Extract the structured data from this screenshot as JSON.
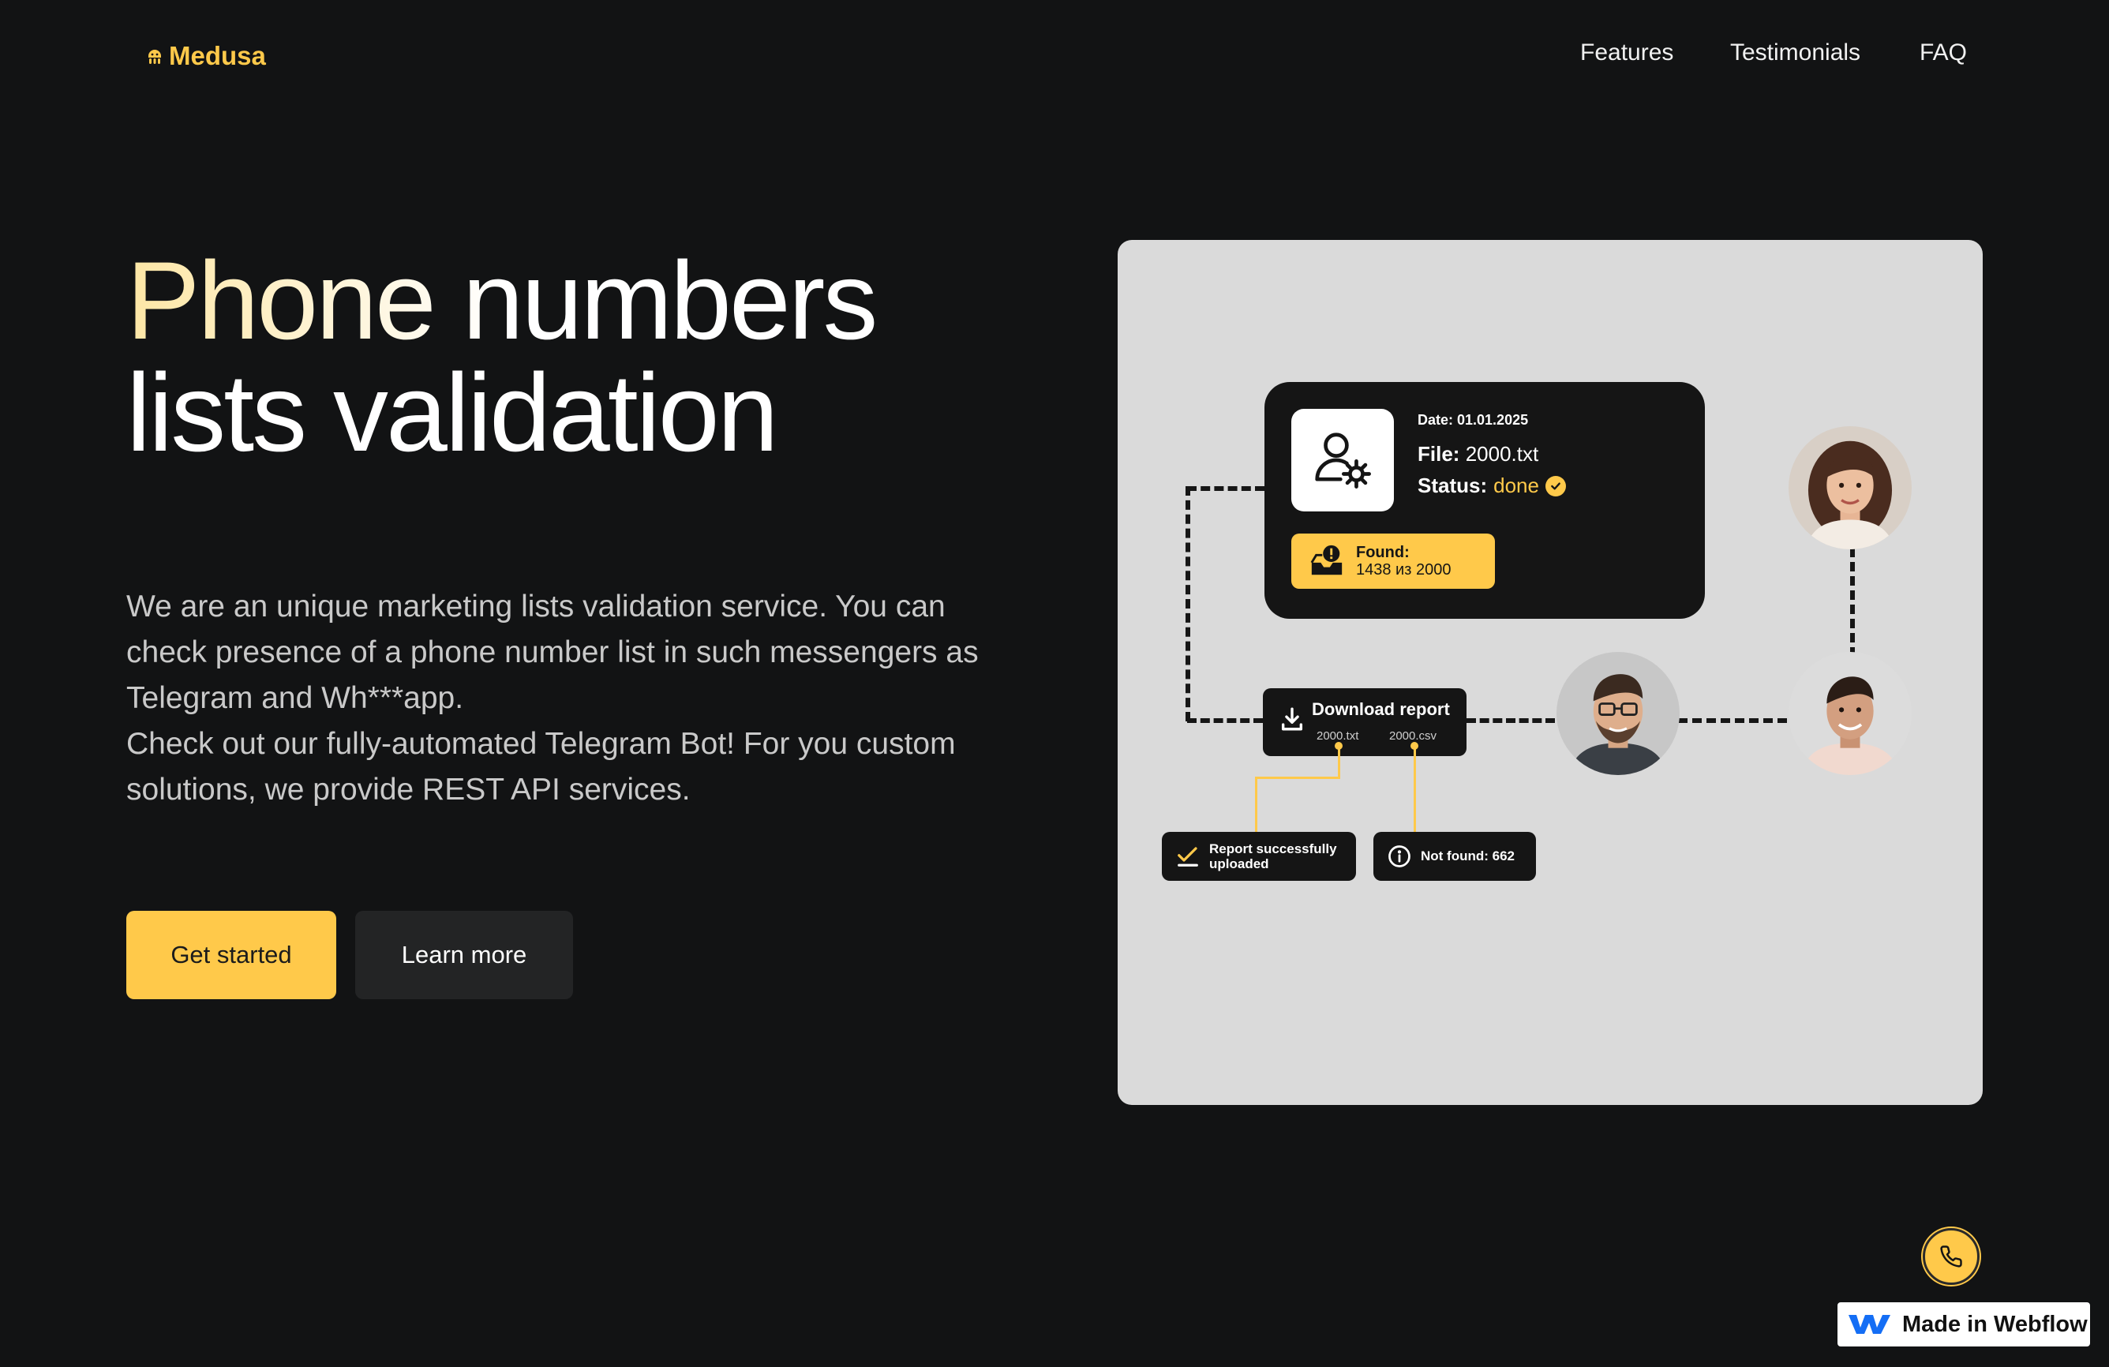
{
  "brand": {
    "name": "Medusa",
    "accent": "#ffc94a",
    "background": "#121314"
  },
  "nav": {
    "items": [
      "Features",
      "Testimonials",
      "FAQ"
    ]
  },
  "hero": {
    "title_line1": "Phone numbers",
    "title_line2": "lists validation",
    "paragraph1": "We are an unique marketing lists validation service. You can check presence of a phone number list in such messengers as Telegram and Wh***app.",
    "paragraph2": "Check out our fully-automated Telegram Bot! For you custom solutions, we provide REST API services.",
    "primary_button": "Get started",
    "secondary_button": "Learn more"
  },
  "illustration": {
    "date": "Date: 01.01.2025",
    "file_label": "File:",
    "file_value": "2000.txt",
    "status_label": "Status:",
    "status_value": "done",
    "found_label": "Found:",
    "found_value": "1438 из 2000",
    "download_title": "Download report",
    "download_file1": "2000.txt",
    "download_file2": "2000.csv",
    "report_status": "Report successfully uploaded",
    "not_found": "Not found: 662",
    "icons": [
      "user-gear-icon",
      "check-circle-icon",
      "alert-inbox-icon",
      "download-icon",
      "checkmark-icon",
      "info-icon"
    ]
  },
  "floating": {
    "call_icon": "phone-icon",
    "webflow_badge": "Made in Webflow"
  }
}
